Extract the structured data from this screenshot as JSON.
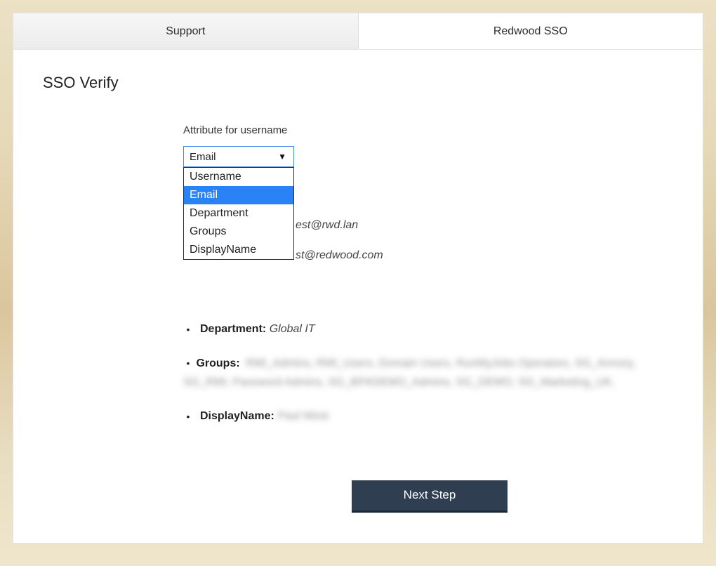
{
  "tabs": {
    "left": "Support",
    "right": "Redwood SSO"
  },
  "page": {
    "title": "SSO Verify"
  },
  "form": {
    "label": "Attribute for username",
    "selected": "Email",
    "options": [
      "Username",
      "Email",
      "Department",
      "Groups",
      "DisplayName"
    ]
  },
  "attributes": {
    "username_partial": "est@rwd.lan",
    "email_partial": "st@redwood.com",
    "department_label": "Department:",
    "department_value": "Global IT",
    "groups_label": "Groups:",
    "groups_value": "RMI_Admins, RMI_Users, Domain Users, RunMyJobs Operators, SG_Armory, SG_RMI, Password Admins, SG_BPADEMO_Admins, SG_DEMO, SG_Marketing_UK,",
    "displayname_label": "DisplayName:",
    "displayname_value": "Paul West"
  },
  "actions": {
    "next": "Next Step"
  }
}
